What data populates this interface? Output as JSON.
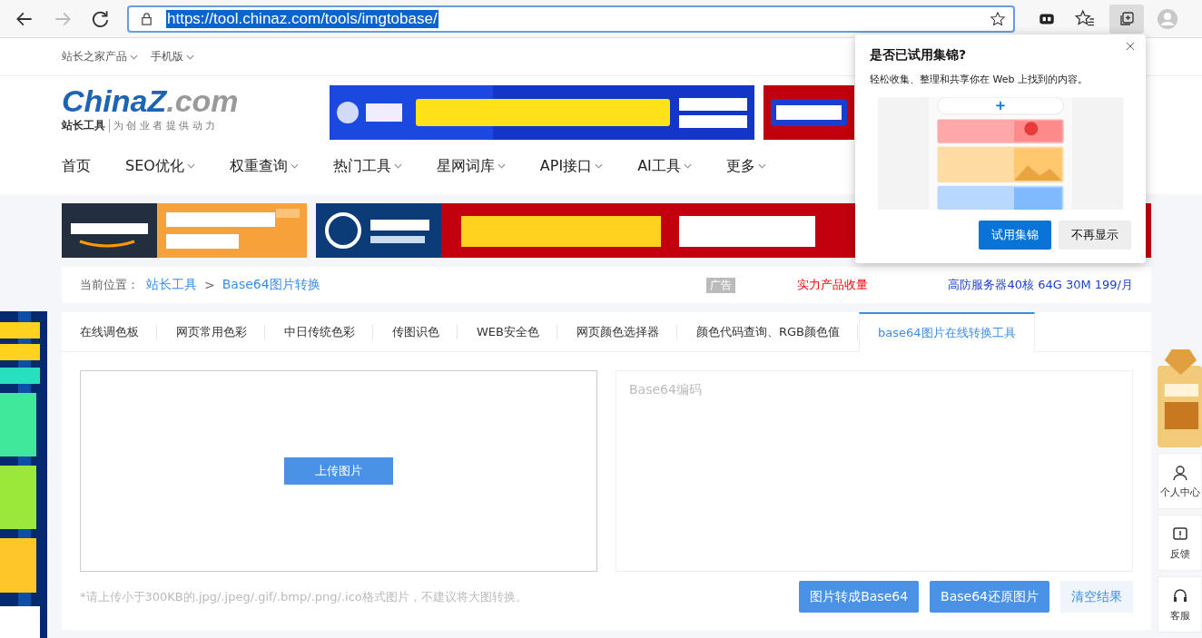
{
  "browser": {
    "url": "https://tool.chinaz.com/tools/imgtobase/"
  },
  "topbar": {
    "links": [
      "站长之家产品",
      "手机版"
    ]
  },
  "logo": {
    "brand": "ChinaZ",
    "domain": ".com",
    "tagline_strong": "站长工具",
    "tagline": "为 创 业 者 提 供 动 力"
  },
  "nav": [
    {
      "label": "首页",
      "dropdown": false
    },
    {
      "label": "SEO优化",
      "dropdown": true
    },
    {
      "label": "权重查询",
      "dropdown": true
    },
    {
      "label": "热门工具",
      "dropdown": true
    },
    {
      "label": "星网词库",
      "dropdown": true
    },
    {
      "label": "API接口",
      "dropdown": true
    },
    {
      "label": "AI工具",
      "dropdown": true
    },
    {
      "label": "更多",
      "dropdown": true
    }
  ],
  "breadcrumb": {
    "prefix": "当前位置：",
    "items": [
      "站长工具",
      "Base64图片转换"
    ],
    "separator": ">"
  },
  "promos": [
    {
      "label": "广告",
      "kind": "tag"
    },
    {
      "label": "实力产品收量",
      "kind": "red"
    },
    {
      "label": "高防服务器40核 64G 30M 199/月",
      "kind": "blue"
    }
  ],
  "tabs": [
    {
      "label": "在线调色板",
      "selected": false
    },
    {
      "label": "网页常用色彩",
      "selected": false
    },
    {
      "label": "中日传统色彩",
      "selected": false
    },
    {
      "label": "传图识色",
      "selected": false
    },
    {
      "label": "WEB安全色",
      "selected": false
    },
    {
      "label": "网页颜色选择器",
      "selected": false
    },
    {
      "label": "颜色代码查询、RGB颜色值",
      "selected": false
    },
    {
      "label": "base64图片在线转换工具",
      "selected": true
    }
  ],
  "editor": {
    "upload_button": "上传图片",
    "output_placeholder": "Base64编码"
  },
  "hint": "*请上传小于300KB的.jpg/.jpeg/.gif/.bmp/.png/.ico格式图片，不建议将大图转换。",
  "actions": [
    {
      "label": "图片转成Base64",
      "kind": "primary"
    },
    {
      "label": "Base64还原图片",
      "kind": "primary"
    },
    {
      "label": "清空结果",
      "kind": "plain"
    }
  ],
  "side_tools": [
    {
      "label": "个人中心",
      "kind": "user"
    },
    {
      "label": "反馈",
      "kind": "feedback"
    },
    {
      "label": "客服",
      "kind": "service"
    }
  ],
  "popup": {
    "title": "是否已试用集锦?",
    "text": "轻松收集、整理和共享你在 Web 上找到的内容。",
    "buttons": [
      {
        "label": "试用集锦",
        "kind": "primary"
      },
      {
        "label": "不再显示",
        "kind": "secondary"
      }
    ]
  }
}
